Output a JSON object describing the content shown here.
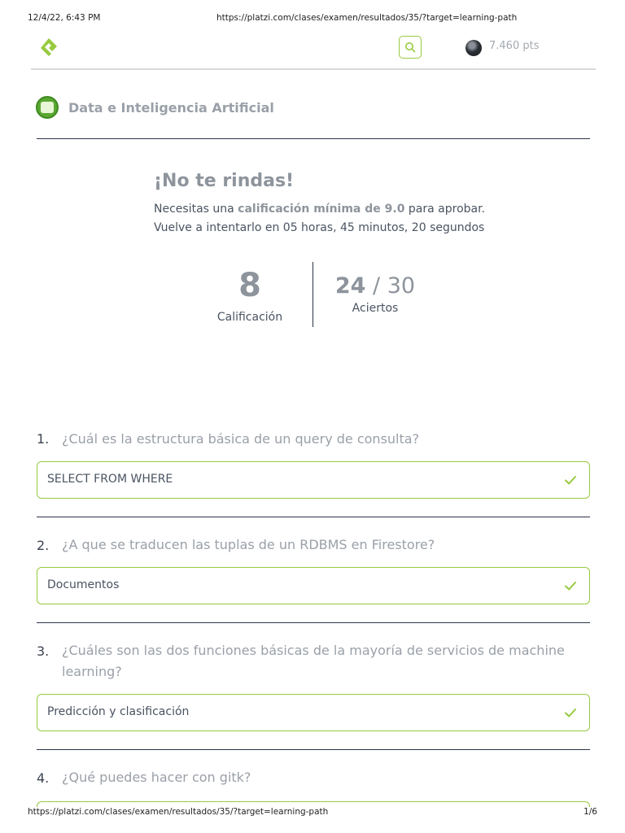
{
  "print": {
    "datetime": "12/4/22, 6:43 PM",
    "header_url": "https://platzi.com/clases/examen/resultados/35/?target=learning-path",
    "footer_url": "https://platzi.com/clases/examen/resultados/35/?target=learning-path",
    "page": "1/6"
  },
  "header": {
    "points": "7.460 pts",
    "icons": [
      "platzi-logo",
      "search-icon",
      "avatar"
    ]
  },
  "school": {
    "title": "Data e Inteligencia Artificial"
  },
  "result": {
    "title": "¡No te rindas!",
    "requirement_pre": "Necesitas una ",
    "requirement_highlight": "calificación mínima de 9.0",
    "requirement_post": " para aprobar.",
    "retry": "Vuelve a intentarlo en 05 horas, 45 minutos, 20 segundos",
    "score": "8",
    "score_label": "Calificación",
    "correct": "24",
    "separator": "/",
    "total": "30",
    "correct_label": "Aciertos"
  },
  "questions": [
    {
      "number": "1.",
      "text": "¿Cuál es la estructura básica de un query de consulta?",
      "answer": "SELECT FROM WHERE",
      "status": "correct"
    },
    {
      "number": "2.",
      "text": "¿A que se traducen las tuplas de un RDBMS en Firestore?",
      "answer": "Documentos",
      "status": "correct"
    },
    {
      "number": "3.",
      "text": "¿Cuáles son las dos funciones básicas de la mayoría de servicios de machine learning?",
      "answer": "Predicción y clasificación",
      "status": "correct"
    },
    {
      "number": "4.",
      "text": "¿Qué puedes hacer con gitk?"
    }
  ],
  "colors": {
    "accent": "#98ca3f",
    "divider": "#2d3448",
    "muted_text": "#9aa0a8",
    "body_text": "#4a5361"
  }
}
